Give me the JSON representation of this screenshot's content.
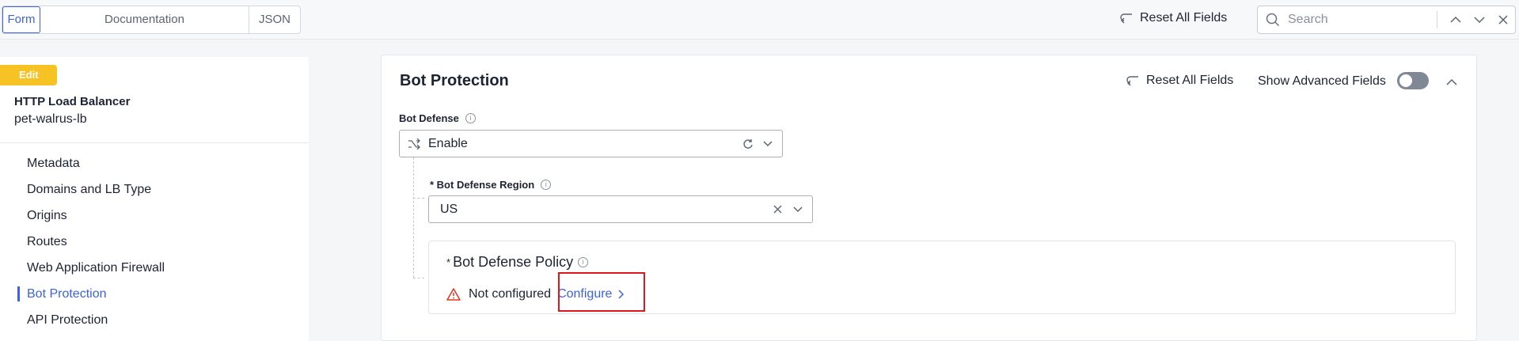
{
  "topbar": {
    "tabs": [
      "Form",
      "Documentation",
      "JSON"
    ],
    "active_tab": "Form",
    "reset_label": "Reset All Fields",
    "search_placeholder": "Search"
  },
  "sidebar": {
    "edit_badge": "Edit",
    "object_type": "HTTP Load Balancer",
    "object_name": "pet-walrus-lb",
    "items": [
      {
        "label": "Metadata",
        "active": false
      },
      {
        "label": "Domains and LB Type",
        "active": false
      },
      {
        "label": "Origins",
        "active": false
      },
      {
        "label": "Routes",
        "active": false
      },
      {
        "label": "Web Application Firewall",
        "active": false
      },
      {
        "label": "Bot Protection",
        "active": true
      },
      {
        "label": "API Protection",
        "active": false
      }
    ]
  },
  "panel": {
    "title": "Bot Protection",
    "reset_label": "Reset All Fields",
    "advanced_label": "Show Advanced Fields",
    "advanced_enabled": false,
    "bot_defense": {
      "label": "Bot Defense",
      "value": "Enable"
    },
    "region": {
      "label": "* Bot Defense Region",
      "value": "US"
    },
    "policy": {
      "required_mark": "*",
      "title": "Bot Defense Policy",
      "status": "Not configured",
      "action": "Configure"
    }
  },
  "colors": {
    "accent": "#3b62e0",
    "edit_badge": "#f7c223",
    "warning": "#e0361c",
    "highlight": "#e0161c"
  }
}
